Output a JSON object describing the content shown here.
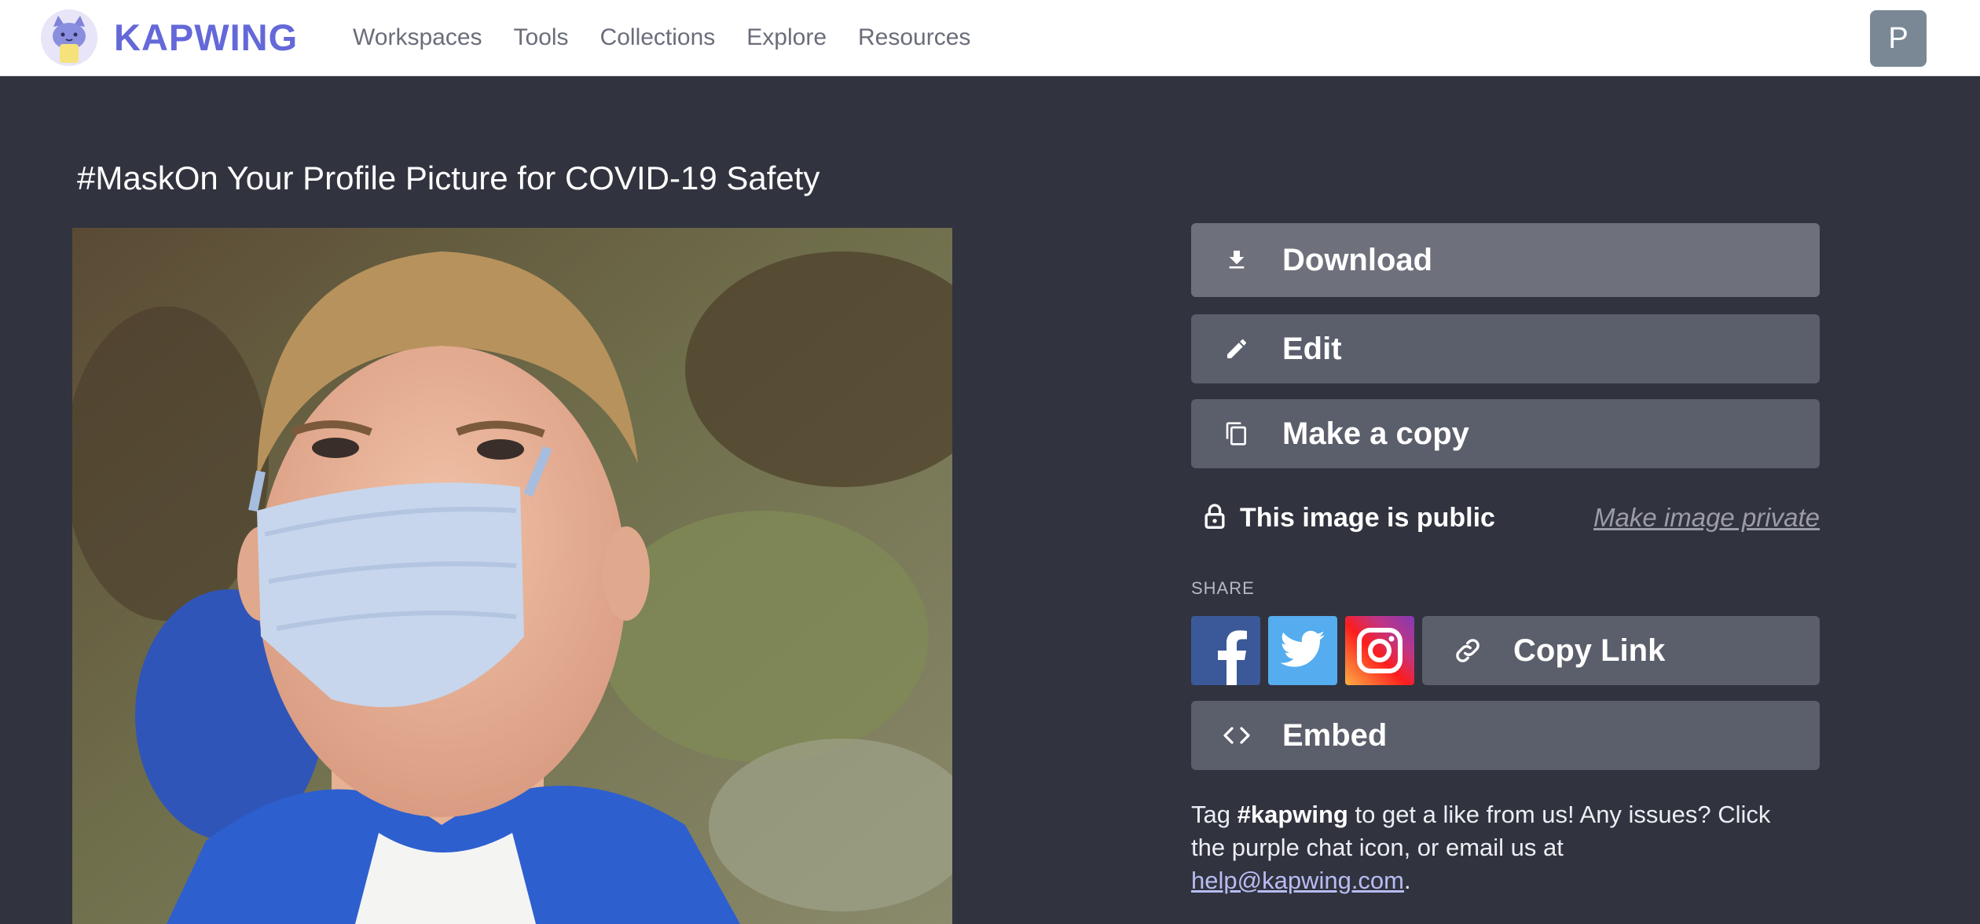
{
  "brand": {
    "name": "KAPWING"
  },
  "nav": {
    "items": [
      {
        "label": "Workspaces"
      },
      {
        "label": "Tools"
      },
      {
        "label": "Collections"
      },
      {
        "label": "Explore"
      },
      {
        "label": "Resources"
      }
    ]
  },
  "user": {
    "avatar_initial": "P"
  },
  "page": {
    "title": "#MaskOn Your Profile Picture for COVID-19 Safety"
  },
  "actions": {
    "download_label": "Download",
    "edit_label": "Edit",
    "copy_label": "Make a copy",
    "embed_label": "Embed"
  },
  "privacy": {
    "status_text": "This image is public",
    "toggle_link": "Make image private"
  },
  "share": {
    "label": "SHARE",
    "copy_link_label": "Copy Link",
    "networks": [
      "facebook",
      "twitter",
      "instagram"
    ]
  },
  "note": {
    "prefix": "Tag ",
    "hashtag": "#kapwing",
    "middle": " to get a like from us! Any issues? Click the purple chat icon, or email us at ",
    "email": "help@kapwing.com",
    "suffix": "."
  },
  "colors": {
    "background": "#31333f",
    "button": "#5b5e6b",
    "brand": "#6468d8"
  }
}
